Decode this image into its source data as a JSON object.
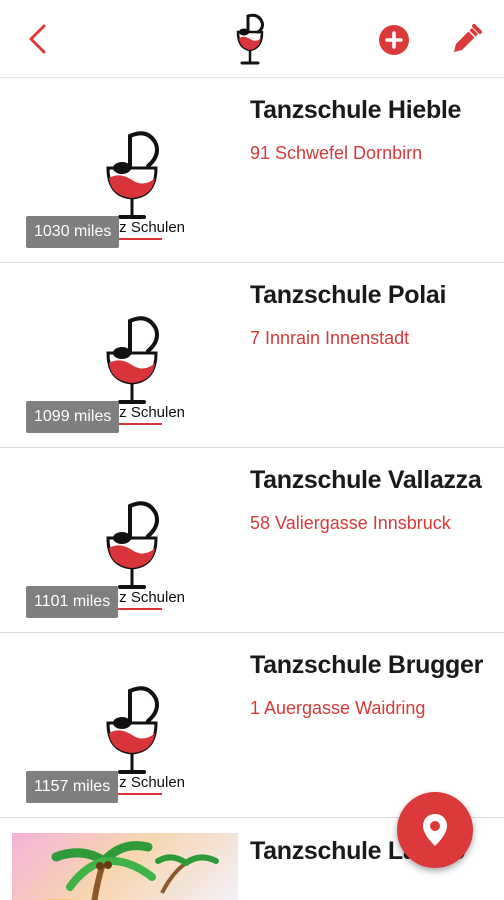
{
  "colors": {
    "accent": "#dc3a3a",
    "text": "#1a1a1a",
    "address": "#d63a3a",
    "badge": "#7f7f7f"
  },
  "header": {
    "back_icon": "chevron-left-icon",
    "logo_icon": "music-note-wineglass-logo",
    "add_icon": "plus-circle-icon",
    "edit_icon": "pencil-icon"
  },
  "logo_caption": "Tanz Schulen",
  "listings": [
    {
      "name": "Tanzschule Hieble",
      "address": "91 Schwefel Dornbirn",
      "distance": "1030 miles"
    },
    {
      "name": "Tanzschule Polai",
      "address": "7 Innrain Innenstadt",
      "distance": "1099 miles"
    },
    {
      "name": "Tanzschule Vallazza",
      "address": "58 Valiergasse Innsbruck",
      "distance": "1101 miles"
    },
    {
      "name": "Tanzschule Brugger",
      "address": "1 Auergasse Waidring",
      "distance": "1157 miles"
    },
    {
      "name": "Tanzschule La Mio"
    }
  ],
  "fab": {
    "icon": "map-pin-icon"
  }
}
